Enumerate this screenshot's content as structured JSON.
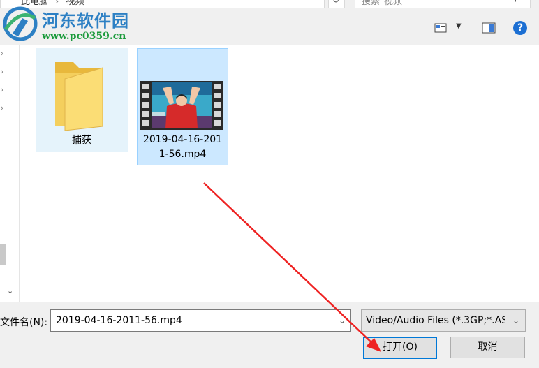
{
  "address_bar": {
    "breadcrumb": [
      "此电脑",
      "视频"
    ],
    "crumb_separator": "›"
  },
  "search": {
    "placeholder": "搜索\"视频\""
  },
  "watermark": {
    "title": "河东软件园",
    "url": "www.pc0359.cn"
  },
  "files": [
    {
      "name": "捕获",
      "type": "folder"
    },
    {
      "name_lines": [
        "2019-04-16-201",
        "1-56.mp4"
      ],
      "type": "video",
      "selected": true
    }
  ],
  "footer": {
    "filename_label": "文件名(N):",
    "filename_value": "2019-04-16-2011-56.mp4",
    "filter_value": "Video/Audio Files (*.3GP;*.AS",
    "open_label": "打开(O)",
    "cancel_label": "取消"
  },
  "icons": {
    "help": "help-icon",
    "view": "view-mode-icon",
    "preview": "preview-pane-icon",
    "refresh": "refresh-icon",
    "search": "search-icon"
  },
  "colors": {
    "accent": "#0078d7",
    "selection_bg": "#cce8ff",
    "selection_border": "#99d1ff",
    "annotation_arrow": "#ee2222",
    "help_blue": "#1c6fd3"
  }
}
